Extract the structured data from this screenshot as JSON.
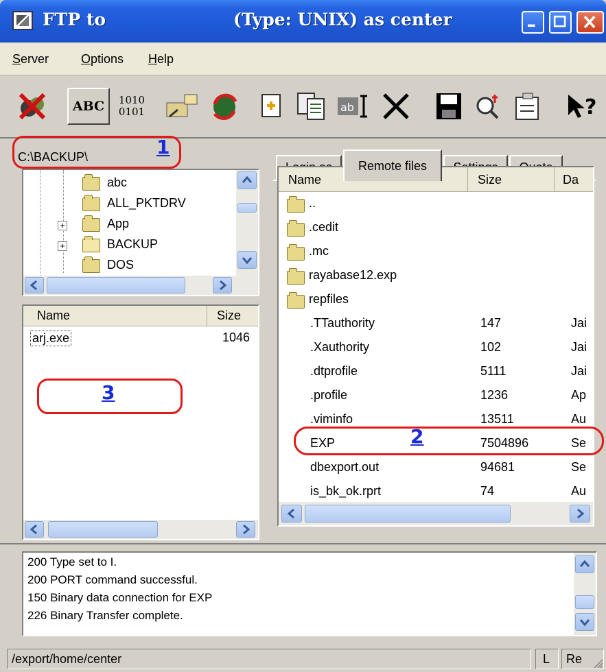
{
  "window": {
    "title_left": "FTP to",
    "title_right": "(Type: UNIX) as center"
  },
  "menu": [
    {
      "label": "Server",
      "accel": "S",
      "rest": "erver"
    },
    {
      "label": "Options",
      "accel": "O",
      "rest": "ptions"
    },
    {
      "label": "Help",
      "accel": "H",
      "rest": "elp"
    }
  ],
  "toolbar": {
    "abc_label": "ABC",
    "binary_line1": "1010",
    "binary_line2": "0101"
  },
  "left": {
    "path": "C:\\BACKUP\\",
    "folders": [
      "abc",
      "ALL_PKTDRV",
      "App",
      "BACKUP",
      "DOS"
    ],
    "file_columns": {
      "name": "Name",
      "size": "Size"
    },
    "files": [
      {
        "name": "arj.exe",
        "size": "1046"
      }
    ]
  },
  "tabs": [
    "Login as",
    "Remote files",
    "Settings",
    "Quote"
  ],
  "remote": {
    "columns": {
      "name": "Name",
      "size": "Size",
      "date": "Da"
    },
    "folders": [
      "..",
      ".cedit",
      ".mc",
      "rayabase12.exp",
      "repfiles"
    ],
    "files": [
      {
        "name": ".TTauthority",
        "size": "147",
        "date": "Jai"
      },
      {
        "name": ".Xauthority",
        "size": "102",
        "date": "Jai"
      },
      {
        "name": ".dtprofile",
        "size": "5111",
        "date": "Jai"
      },
      {
        "name": ".profile",
        "size": "1236",
        "date": "Ap"
      },
      {
        "name": ".viminfo",
        "size": "13511",
        "date": "Au"
      },
      {
        "name": "EXP",
        "size": "7504896",
        "date": "Se"
      },
      {
        "name": "dbexport.out",
        "size": "94681",
        "date": "Se"
      },
      {
        "name": "is_bk_ok.rprt",
        "size": "74",
        "date": "Au"
      }
    ]
  },
  "log": [
    "200 Type set to I.",
    "200 PORT command successful.",
    "150 Binary data connection for EXP",
    "226 Binary Transfer complete."
  ],
  "status": {
    "path": "/export/home/center",
    "cell1": "L",
    "cell2": "Re"
  },
  "annotations": [
    "1",
    "2",
    "3"
  ],
  "colors": {
    "annotation_ring": "#e01a1a",
    "annotation_number": "#1a2cd6",
    "titlebar": "#1f5ad7"
  }
}
